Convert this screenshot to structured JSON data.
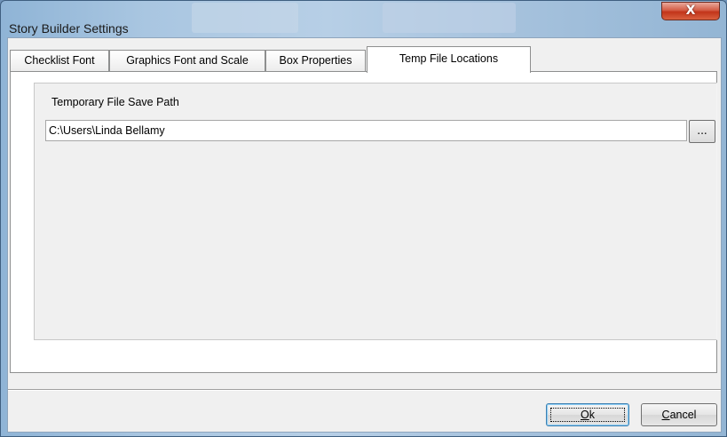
{
  "window": {
    "title": "Story Builder Settings",
    "close_label": "X"
  },
  "tabs": [
    {
      "label": "Checklist Font",
      "active": false
    },
    {
      "label": "Graphics Font and Scale",
      "active": false
    },
    {
      "label": "Box Properties",
      "active": false
    },
    {
      "label": "Temp File Locations",
      "active": true
    }
  ],
  "temp_file": {
    "group_label": "Temporary File Save Path",
    "path_value": "C:\\Users\\Linda Bellamy",
    "browse_label": "..."
  },
  "footer": {
    "ok_label": "Ok",
    "ok_mnemonic": "O",
    "ok_rest": "k",
    "cancel_label": "Cancel",
    "cancel_mnemonic": "C",
    "cancel_rest": "ancel"
  },
  "colors": {
    "close_button": "#c2341a",
    "window_frame": "#a9c6e1",
    "dialog_bg": "#f0f0f0"
  }
}
